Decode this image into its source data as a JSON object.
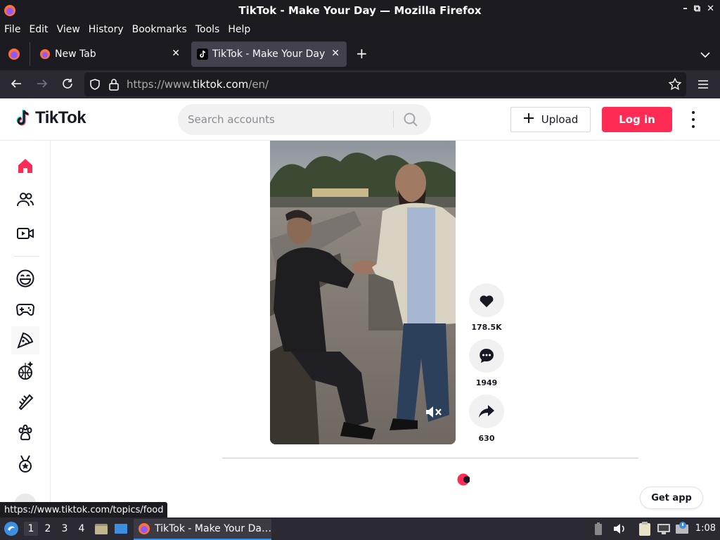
{
  "window": {
    "title": "TikTok - Make Your Day — Mozilla Firefox"
  },
  "menu": [
    "File",
    "Edit",
    "View",
    "History",
    "Bookmarks",
    "Tools",
    "Help"
  ],
  "tabs": [
    {
      "label": "New Tab"
    },
    {
      "label": "TikTok - Make Your Day"
    }
  ],
  "nav": {
    "url_prefix": "https://www.",
    "url_host": "tiktok.com",
    "url_path": "/en/"
  },
  "tiktok": {
    "brand": "TikTok",
    "search_placeholder": "Search accounts",
    "upload_label": "Upload",
    "login_label": "Log in",
    "actions": {
      "likes": "178.5K",
      "comments": "1949",
      "shares": "630"
    },
    "get_app_label": "Get app"
  },
  "status_url": "https://www.tiktok.com/topics/food",
  "taskbar": {
    "workspaces": [
      "1",
      "2",
      "3",
      "4"
    ],
    "app_label": "TikTok - Make Your Da…",
    "clock": "1:08"
  },
  "colors": {
    "brand_red": "#fe2c55",
    "chrome_dark": "#1c1b22",
    "chrome_mid": "#2b2a33"
  }
}
